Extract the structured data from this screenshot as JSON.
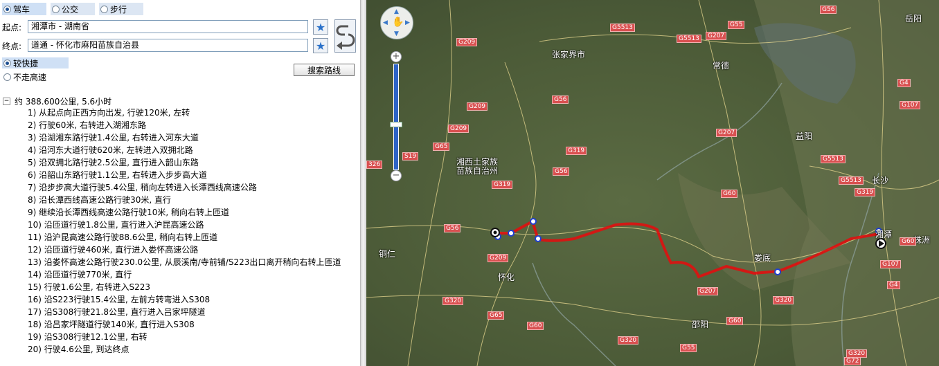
{
  "modes": [
    {
      "label": "驾车",
      "selected": true
    },
    {
      "label": "公交",
      "selected": false
    },
    {
      "label": "步行",
      "selected": false
    }
  ],
  "start": {
    "label": "起点:",
    "value": "湘潭市 - 湖南省"
  },
  "end": {
    "label": "终点:",
    "value": "道通 - 怀化市麻阳苗族自治县"
  },
  "options": [
    {
      "label": "较快捷",
      "selected": true
    },
    {
      "label": "不走高速",
      "selected": false
    }
  ],
  "search_button": "搜索路线",
  "summary": {
    "toggle": "−",
    "text": "约 388.600公里, 5.6小时"
  },
  "steps": [
    "1) 从起点向正西方向出发, 行驶120米, 左转",
    "2) 行驶60米, 右转进入湖湘东路",
    "3) 沿湖湘东路行驶1.4公里, 右转进入河东大道",
    "4) 沿河东大道行驶620米, 左转进入双拥北路",
    "5) 沿双拥北路行驶2.5公里, 直行进入韶山东路",
    "6) 沿韶山东路行驶1.1公里, 右转进入步步高大道",
    "7) 沿步步高大道行驶5.4公里, 稍向左转进入长潭西线高速公路",
    "8) 沿长潭西线高速公路行驶30米, 直行",
    "9) 继续沿长潭西线高速公路行驶10米, 稍向右转上匝道",
    "10) 沿匝道行驶1.8公里, 直行进入沪昆高速公路",
    "11) 沿沪昆高速公路行驶88.6公里, 稍向右转上匝道",
    "12) 沿匝道行驶460米, 直行进入娄怀高速公路",
    "13) 沿娄怀高速公路行驶230.0公里, 从辰溪南/寺前铺/S223出口离开稍向右转上匝道",
    "14) 沿匝道行驶770米, 直行",
    "15) 行驶1.6公里, 右转进入S223",
    "16) 沿S223行驶15.4公里, 左前方转弯进入S308",
    "17) 沿S308行驶21.8公里, 直行进入吕家坪隧道",
    "18) 沿吕家坪隧道行驶140米, 直行进入S308",
    "19) 沿S308行驶12.1公里, 右转",
    "20) 行驶4.6公里, 到达终点"
  ],
  "map": {
    "cities": [
      "张家界市",
      "常德",
      "湘西土家族苗族自治州",
      "益阳",
      "长沙",
      "娄底",
      "怀化",
      "铜仁",
      "邵阳",
      "株洲",
      "岳阳",
      "湘潭"
    ],
    "road_labels": [
      "G56",
      "G5513",
      "G207",
      "G55",
      "G209",
      "G5513",
      "G4",
      "G107",
      "G209",
      "G209",
      "G65",
      "G319",
      "G56",
      "G207",
      "G5513",
      "G319",
      "G319",
      "G56",
      "G56",
      "G209",
      "G60",
      "G207",
      "G320",
      "G320",
      "G60",
      "G320",
      "G65",
      "G60",
      "G55",
      "G320",
      "G107",
      "G4",
      "G60",
      "G72",
      "326",
      "S19",
      "G5513"
    ],
    "colors": {
      "route": "#e01010",
      "road_label_bg": "#d95050",
      "satellite": "#4a5a3a"
    }
  }
}
